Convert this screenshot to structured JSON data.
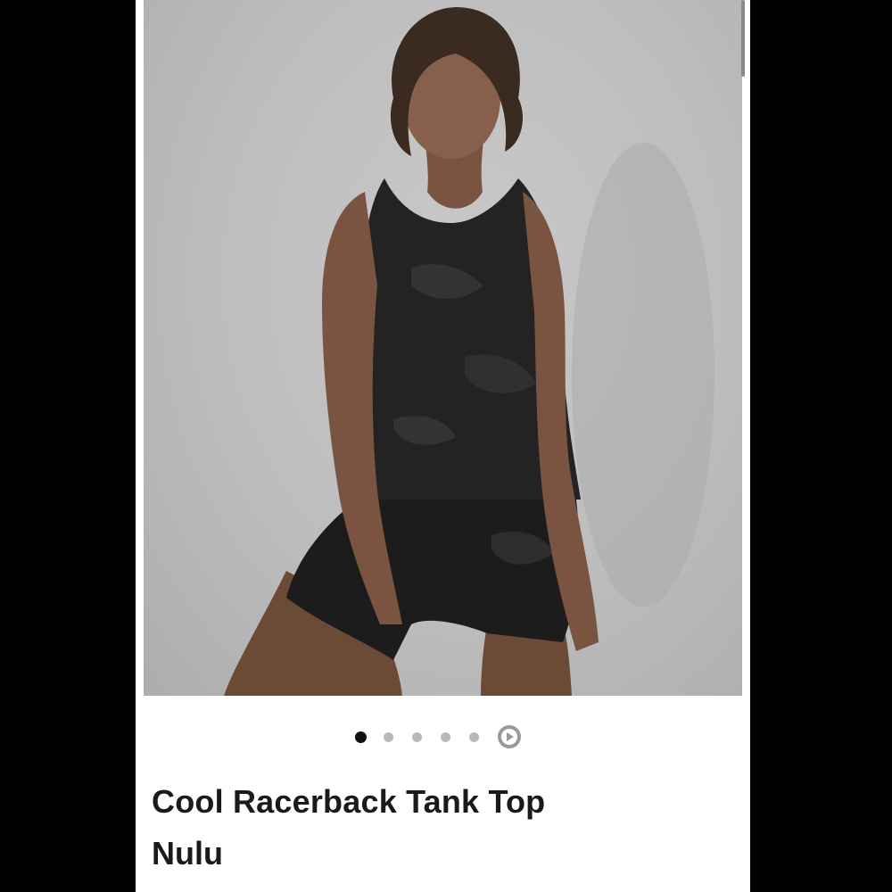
{
  "product": {
    "image_alt": "Model wearing black camo racerback tank top and shorts",
    "title": "Cool Racerback Tank Top",
    "fabric": "Nulu"
  },
  "carousel": {
    "count": 6,
    "active_index": 0,
    "last_item_icon": "play-video-icon"
  },
  "colors": {
    "background": "#000000",
    "card": "#ffffff",
    "photo_bg": "#bdbdbd",
    "text": "#1a1a1a",
    "dot_active": "#111111",
    "dot_inactive": "#b9b9b9"
  }
}
